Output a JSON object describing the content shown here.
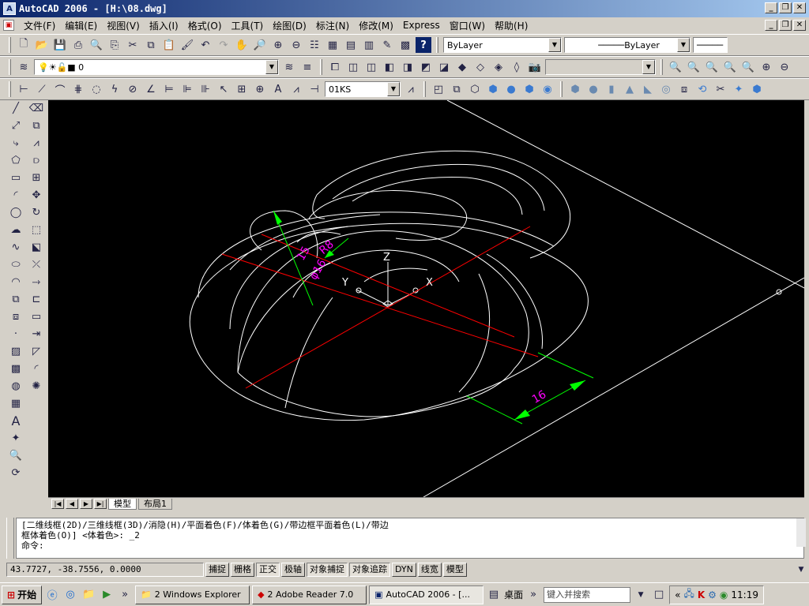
{
  "window": {
    "title": "AutoCAD 2006 - [H:\\08.dwg]"
  },
  "menu": {
    "items": [
      "文件(F)",
      "编辑(E)",
      "视图(V)",
      "插入(I)",
      "格式(O)",
      "工具(T)",
      "绘图(D)",
      "标注(N)",
      "修改(M)",
      "Express",
      "窗口(W)",
      "帮助(H)"
    ]
  },
  "toolbar1": {
    "color_combo": "ByLayer",
    "linetype_combo": "ByLayer"
  },
  "toolbar2": {
    "layer_combo": "0"
  },
  "toolbar3": {
    "dimstyle_combo": "01KS"
  },
  "drawing": {
    "dimensions": [
      "R8",
      "15",
      "16",
      "φ16"
    ],
    "ucs": {
      "z": "Z",
      "y": "Y",
      "x": "X"
    },
    "colors": {
      "wire": "#ffffff",
      "center": "#ff0000",
      "dim": "#00ff00",
      "dimtext": "#ff00ff",
      "background": "#000000"
    }
  },
  "layout_tabs": [
    "模型",
    "布局1"
  ],
  "command": {
    "line1": "[二维线框(2D)/三维线框(3D)/消隐(H)/平面着色(F)/体着色(G)/带边框平面着色(L)/带边",
    "line2": "框体着色(O)] <体着色>: _2",
    "line3": "命令:"
  },
  "status": {
    "coords": "43.7727, -38.7556, 0.0000",
    "buttons": [
      "捕捉",
      "栅格",
      "正交",
      "极轴",
      "对象捕捉",
      "对象追踪",
      "DYN",
      "线宽",
      "模型"
    ],
    "active": [
      "正交",
      "对象捕捉",
      "对象追踪"
    ]
  },
  "taskbar": {
    "start": "开始",
    "tasks": [
      "2 Windows Explorer",
      "2 Adobe Reader 7.0",
      "AutoCAD 2006 - [..."
    ],
    "desktop": "桌面",
    "search_placeholder": "键入并搜索",
    "clock": "11:19"
  }
}
